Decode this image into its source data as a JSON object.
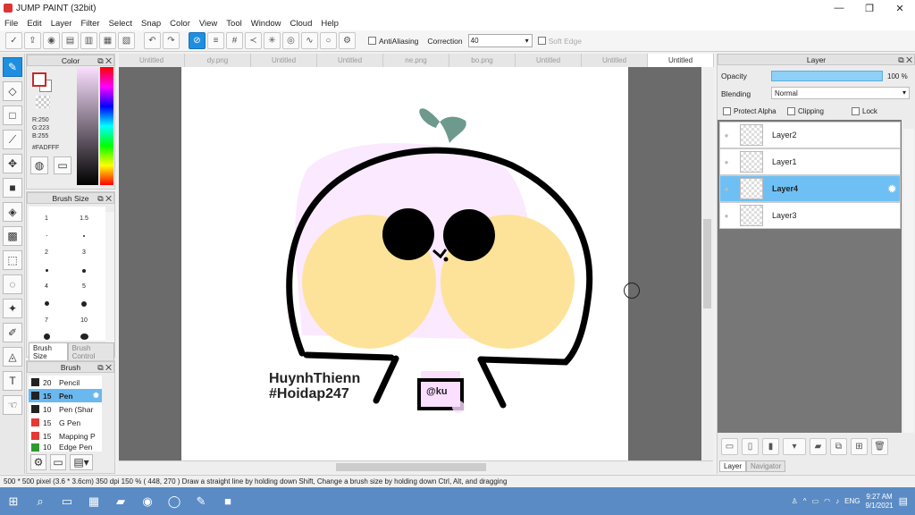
{
  "window": {
    "title": "JUMP PAINT (32bit)"
  },
  "menu": [
    "File",
    "Edit",
    "Layer",
    "Filter",
    "Select",
    "Snap",
    "Color",
    "View",
    "Tool",
    "Window",
    "Cloud",
    "Help"
  ],
  "toolbar": {
    "antialiasing": "AntiAliasing",
    "correction_label": "Correction",
    "correction_value": "40",
    "soft_edge": "Soft Edge"
  },
  "color_panel": {
    "title": "Color",
    "r": "R:250",
    "g": "G:223",
    "b": "B:255",
    "hex": "#FADFFF"
  },
  "brush_size_panel": {
    "title": "Brush Size",
    "sizes": [
      "1",
      "1.5",
      "2",
      "3",
      "4",
      "5",
      "7",
      "10"
    ],
    "tabs": [
      "Brush Size",
      "Brush Control"
    ]
  },
  "brush_panel": {
    "title": "Brush",
    "items": [
      {
        "size": "20",
        "name": "Pencil",
        "color": "#222222"
      },
      {
        "size": "15",
        "name": "Pen",
        "color": "#222222"
      },
      {
        "size": "10",
        "name": "Pen (Shar",
        "color": "#222222"
      },
      {
        "size": "15",
        "name": "G Pen",
        "color": "#e53935"
      },
      {
        "size": "15",
        "name": "Mapping P",
        "color": "#e53935"
      },
      {
        "size": "10",
        "name": "Edge Pen",
        "color": "#2e9a2e"
      }
    ]
  },
  "doc_tabs": [
    "Untitled",
    "dy.png",
    "Untitled",
    "Untitled",
    "ne.png",
    "bo.png",
    "Untitled",
    "Untitled",
    "Untitled"
  ],
  "artwork": {
    "text_line1": "HuynhThienn",
    "text_line2": "#Hoidap247",
    "badge": "@ku"
  },
  "layer_panel": {
    "title": "Layer",
    "opacity_label": "Opacity",
    "opacity_value": "100 %",
    "blending_label": "Blending",
    "blending_value": "Normal",
    "protect_alpha": "Protect Alpha",
    "clipping": "Clipping",
    "lock": "Lock",
    "layers": [
      "Layer2",
      "Layer1",
      "Layer4",
      "Layer3"
    ],
    "tabs": [
      "Layer",
      "Navigator"
    ]
  },
  "status": {
    "text": "500 * 500 pixel   (3.6 * 3.6cm)   350 dpi   150 %   ( 448, 270 )   Draw a straight line by holding down Shift, Change a brush size by holding down Ctrl, Alt, and dragging"
  },
  "taskbar": {
    "lang": "ENG",
    "time": "9:27 AM",
    "date": "9/1/2021"
  }
}
